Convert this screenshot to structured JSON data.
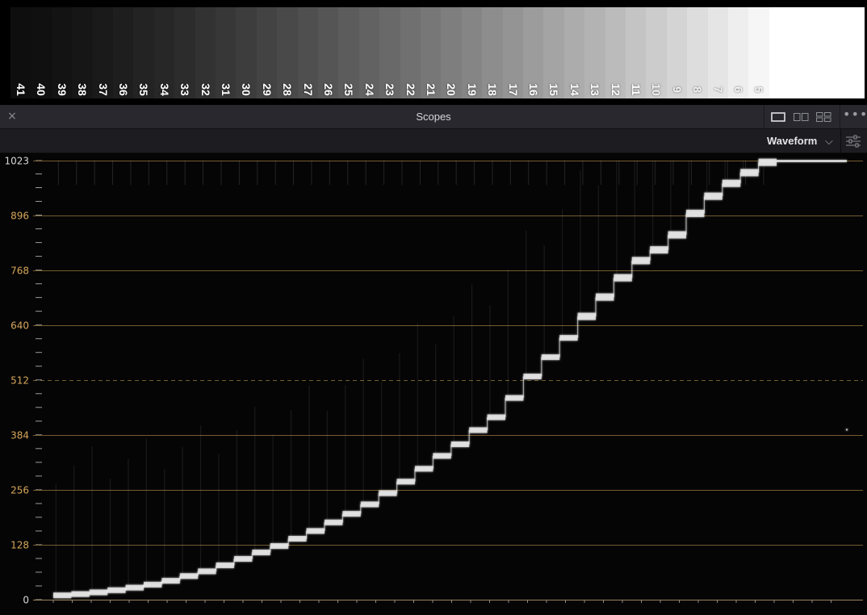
{
  "step_wedge": {
    "labels": [
      "41",
      "40",
      "39",
      "38",
      "37",
      "36",
      "35",
      "34",
      "33",
      "32",
      "31",
      "30",
      "29",
      "28",
      "27",
      "26",
      "25",
      "24",
      "23",
      "22",
      "21",
      "20",
      "19",
      "18",
      "17",
      "16",
      "15",
      "14",
      "13",
      "12",
      "11",
      "10",
      "9",
      "8",
      "7",
      "6",
      "5"
    ]
  },
  "header": {
    "close_label": "×",
    "title": "Scopes",
    "more_label": "•••"
  },
  "toolbar": {
    "scope_type": "Waveform",
    "chevron": "⌵"
  },
  "waveform": {
    "y_ticks": [
      "0",
      "128",
      "256",
      "384",
      "512",
      "640",
      "768",
      "896",
      "1023"
    ],
    "y_range": [
      0,
      1023
    ],
    "graticule_color": "#8a6a38",
    "label_color": "#d6a65a",
    "trace_color": "#ffffff"
  }
}
